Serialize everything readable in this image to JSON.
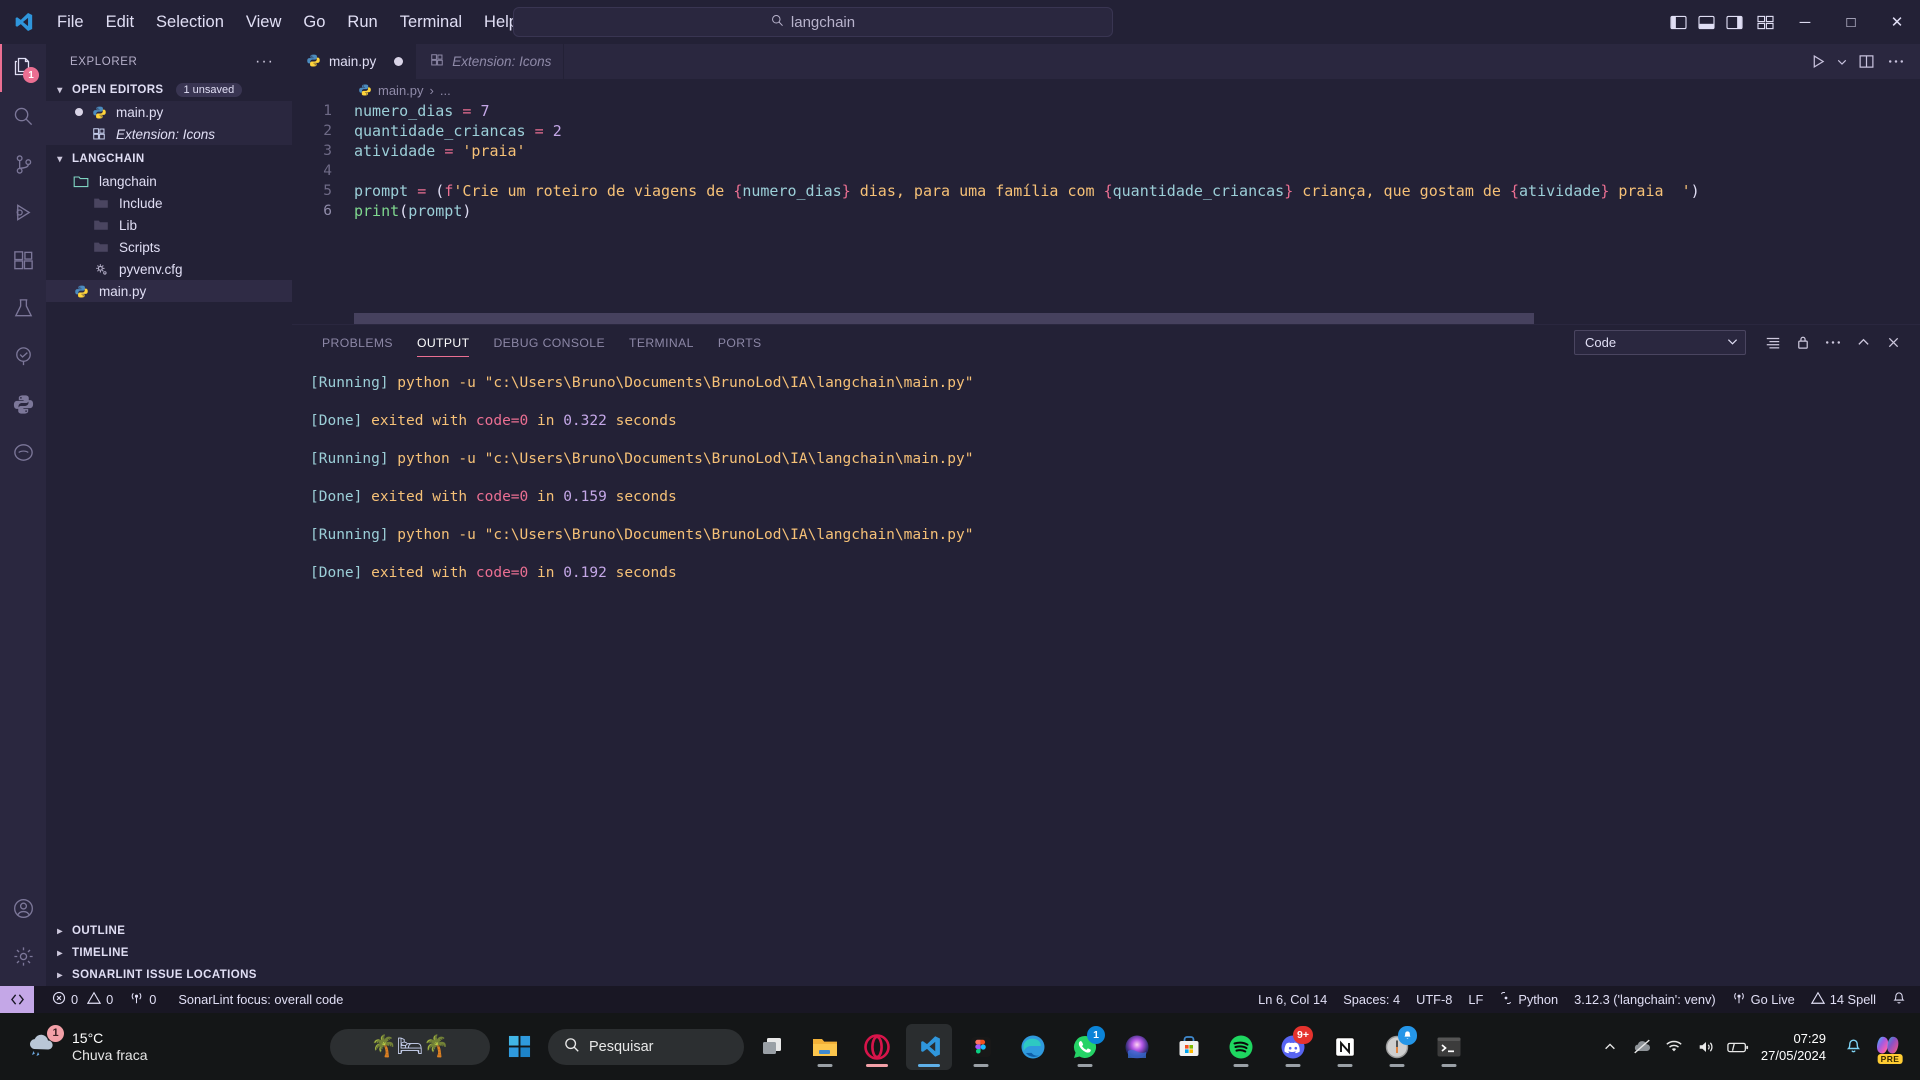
{
  "titlebar": {
    "menus": [
      "File",
      "Edit",
      "Selection",
      "View",
      "Go",
      "Run",
      "Terminal",
      "Help"
    ],
    "back_icon": "arrow-left-icon",
    "forward_icon": "arrow-right-icon",
    "command_center_value": "langchain",
    "command_center_icon": "search-icon",
    "layout_icons": [
      "toggle-primary-sidebar-icon",
      "toggle-panel-icon",
      "toggle-secondary-sidebar-icon",
      "customize-layout-icon"
    ],
    "window_controls": {
      "minimize": "─",
      "maximize": "□",
      "close": "✕"
    }
  },
  "activitybar": {
    "items": [
      {
        "name": "explorer",
        "icon": "files-icon",
        "active": true,
        "badge": "1"
      },
      {
        "name": "search",
        "icon": "search-icon",
        "active": false,
        "badge": ""
      },
      {
        "name": "source-control",
        "icon": "source-control-icon",
        "active": false,
        "badge": ""
      },
      {
        "name": "run-and-debug",
        "icon": "debug-icon",
        "active": false,
        "badge": ""
      },
      {
        "name": "extensions",
        "icon": "extensions-icon",
        "active": false,
        "badge": ""
      },
      {
        "name": "testing",
        "icon": "beaker-icon",
        "active": false,
        "badge": ""
      },
      {
        "name": "sonarlint",
        "icon": "sonarlint-tree-icon",
        "active": false,
        "badge": ""
      },
      {
        "name": "python",
        "icon": "python-icon",
        "active": false,
        "badge": ""
      },
      {
        "name": "docker",
        "icon": "docker-icon",
        "active": false,
        "badge": ""
      }
    ],
    "bottom": [
      {
        "name": "accounts",
        "icon": "account-icon"
      },
      {
        "name": "manage",
        "icon": "gear-icon"
      }
    ]
  },
  "sidebar": {
    "title": "EXPLORER",
    "more_actions": "···",
    "open_editors": {
      "label": "OPEN EDITORS",
      "badge": "1 unsaved",
      "items": [
        {
          "label": "main.py",
          "icon": "python-file-icon",
          "dirty": true,
          "italic": false
        },
        {
          "label": "Extension: Icons",
          "icon": "extensions-icon",
          "dirty": false,
          "italic": true
        }
      ]
    },
    "folder": {
      "label": "LANGCHAIN",
      "items": [
        {
          "label": "langchain",
          "icon": "folder-open-icon",
          "depth": 1
        },
        {
          "label": "Include",
          "icon": "folder-icon",
          "depth": 2
        },
        {
          "label": "Lib",
          "icon": "folder-icon",
          "depth": 2
        },
        {
          "label": "Scripts",
          "icon": "folder-icon",
          "depth": 2
        },
        {
          "label": "pyvenv.cfg",
          "icon": "config-file-icon",
          "depth": 2
        },
        {
          "label": "main.py",
          "icon": "python-file-icon",
          "depth": 1
        }
      ]
    },
    "bottom_sections": [
      "OUTLINE",
      "TIMELINE",
      "SONARLINT ISSUE LOCATIONS"
    ]
  },
  "editor": {
    "tabs": [
      {
        "label": "main.py",
        "icon": "python-file-icon",
        "active": true,
        "dirty": true,
        "italic": false
      },
      {
        "label": "Extension: Icons",
        "icon": "extensions-icon",
        "active": false,
        "dirty": false,
        "italic": true
      }
    ],
    "actions": [
      "run-python-file-icon",
      "chevron-down-icon",
      "split-editor-icon",
      "more-actions-icon"
    ],
    "breadcrumb": {
      "file": "main.py",
      "icon": "python-file-icon",
      "separator": "›",
      "rest": "..."
    },
    "lines": [
      {
        "n": "1",
        "tokens": [
          {
            "t": "numero_dias",
            "c": "c-var"
          },
          {
            "t": " ",
            "c": ""
          },
          {
            "t": "=",
            "c": "c-op"
          },
          {
            "t": " ",
            "c": ""
          },
          {
            "t": "7",
            "c": "c-num"
          }
        ]
      },
      {
        "n": "2",
        "tokens": [
          {
            "t": "quantidade_criancas",
            "c": "c-var"
          },
          {
            "t": " ",
            "c": ""
          },
          {
            "t": "=",
            "c": "c-op"
          },
          {
            "t": " ",
            "c": ""
          },
          {
            "t": "2",
            "c": "c-num"
          }
        ]
      },
      {
        "n": "3",
        "tokens": [
          {
            "t": "atividade",
            "c": "c-var"
          },
          {
            "t": " ",
            "c": ""
          },
          {
            "t": "=",
            "c": "c-op"
          },
          {
            "t": " ",
            "c": ""
          },
          {
            "t": "'praia'",
            "c": "c-str"
          }
        ]
      },
      {
        "n": "4",
        "tokens": []
      },
      {
        "n": "5",
        "tokens": [
          {
            "t": "prompt",
            "c": "c-var"
          },
          {
            "t": " ",
            "c": ""
          },
          {
            "t": "=",
            "c": "c-op"
          },
          {
            "t": " ",
            "c": ""
          },
          {
            "t": "(",
            "c": "c-punc"
          },
          {
            "t": "f",
            "c": "c-op"
          },
          {
            "t": "'Crie um roteiro de viagens de ",
            "c": "c-str"
          },
          {
            "t": "{",
            "c": "c-brace"
          },
          {
            "t": "numero_dias",
            "c": "c-var"
          },
          {
            "t": "}",
            "c": "c-brace"
          },
          {
            "t": " dias, para uma família com ",
            "c": "c-str"
          },
          {
            "t": "{",
            "c": "c-brace"
          },
          {
            "t": "quantidade_criancas",
            "c": "c-var"
          },
          {
            "t": "}",
            "c": "c-brace"
          },
          {
            "t": " criança, que gostam de ",
            "c": "c-str"
          },
          {
            "t": "{",
            "c": "c-brace"
          },
          {
            "t": "atividade",
            "c": "c-var"
          },
          {
            "t": "}",
            "c": "c-brace"
          },
          {
            "t": " praia  '",
            "c": "c-str"
          },
          {
            "t": ")",
            "c": "c-punc"
          }
        ]
      },
      {
        "n": "6",
        "tokens": [
          {
            "t": "print",
            "c": "c-fn"
          },
          {
            "t": "(",
            "c": "c-punc"
          },
          {
            "t": "prompt",
            "c": "c-var"
          },
          {
            "t": ")",
            "c": "c-punc"
          }
        ]
      }
    ]
  },
  "panel": {
    "tabs": [
      "PROBLEMS",
      "OUTPUT",
      "DEBUG CONSOLE",
      "TERMINAL",
      "PORTS"
    ],
    "active_tab": "OUTPUT",
    "channel_select": {
      "value": "Code",
      "icon": "chevron-down-icon"
    },
    "actions": [
      "clear-output-icon",
      "lock-scroll-icon",
      "more-actions-icon",
      "maximize-panel-icon",
      "close-panel-icon"
    ],
    "lines": [
      {
        "type": "running",
        "tag": "[Running]",
        "cmd": " python -u ",
        "path": "\"c:\\Users\\Bruno\\Documents\\BrunoLod\\IA\\langchain\\main.py\""
      },
      {
        "type": "blank"
      },
      {
        "type": "done",
        "tag": "[Done]",
        "mid": " exited with ",
        "code": "code=0",
        "in": " in ",
        "num": "0.322",
        "unit": " seconds"
      },
      {
        "type": "blank"
      },
      {
        "type": "running",
        "tag": "[Running]",
        "cmd": " python -u ",
        "path": "\"c:\\Users\\Bruno\\Documents\\BrunoLod\\IA\\langchain\\main.py\""
      },
      {
        "type": "blank"
      },
      {
        "type": "done",
        "tag": "[Done]",
        "mid": " exited with ",
        "code": "code=0",
        "in": " in ",
        "num": "0.159",
        "unit": " seconds"
      },
      {
        "type": "blank"
      },
      {
        "type": "running",
        "tag": "[Running]",
        "cmd": " python -u ",
        "path": "\"c:\\Users\\Bruno\\Documents\\BrunoLod\\IA\\langchain\\main.py\""
      },
      {
        "type": "blank"
      },
      {
        "type": "done",
        "tag": "[Done]",
        "mid": " exited with ",
        "code": "code=0",
        "in": " in ",
        "num": "0.192",
        "unit": " seconds"
      }
    ]
  },
  "statusbar": {
    "remote_icon": "remote-window-icon",
    "errors": "0",
    "warnings": "0",
    "ports": "0",
    "sonarlint": "SonarLint focus: overall code",
    "position": "Ln 6, Col 14",
    "spaces": "Spaces: 4",
    "encoding": "UTF-8",
    "eol": "LF",
    "language": "Python",
    "interpreter": "3.12.3 ('langchain': venv)",
    "golive": "Go Live",
    "spell": "14 Spell",
    "bell_icon": "bell-icon"
  },
  "taskbar": {
    "weather": {
      "temp": "15°C",
      "desc": "Chuva fraca",
      "badge": "1",
      "icon": "rain-cloud-icon"
    },
    "pill_icon": "palm-hammock-icon",
    "start_icon": "windows-start-icon",
    "search": {
      "placeholder": "Pesquisar",
      "icon": "search-icon"
    },
    "apps": [
      {
        "name": "task-view",
        "icon": "task-view-icon",
        "badge": "",
        "open": false
      },
      {
        "name": "file-explorer",
        "icon": "folder-icon",
        "badge": "",
        "open": true
      },
      {
        "name": "opera",
        "icon": "opera-icon",
        "badge": "",
        "open": true
      },
      {
        "name": "vscode",
        "icon": "vscode-icon",
        "badge": "",
        "open": true,
        "active": true
      },
      {
        "name": "figma",
        "icon": "figma-icon",
        "badge": "",
        "open": true
      },
      {
        "name": "edge",
        "icon": "edge-icon",
        "badge": "",
        "open": false
      },
      {
        "name": "whatsapp",
        "icon": "whatsapp-icon",
        "badge": "1",
        "open": true
      },
      {
        "name": "media-player",
        "icon": "media-icon",
        "badge": "",
        "open": false
      },
      {
        "name": "microsoft-store",
        "icon": "store-icon",
        "badge": "",
        "open": false
      },
      {
        "name": "spotify",
        "icon": "spotify-icon",
        "badge": "",
        "open": true
      },
      {
        "name": "discord",
        "icon": "discord-icon",
        "badge": "9+",
        "open": true
      },
      {
        "name": "notion",
        "icon": "notion-icon",
        "badge": "",
        "open": true
      },
      {
        "name": "clock",
        "icon": "clock-icon",
        "badge": "bell",
        "open": true
      },
      {
        "name": "terminal",
        "icon": "terminal-icon",
        "badge": "",
        "open": true
      }
    ],
    "tray": {
      "chevron": "show-hidden-icons-icon",
      "icons": [
        "onedrive-offline-icon",
        "wifi-icon",
        "volume-icon",
        "battery-icon"
      ],
      "time": "07:29",
      "date": "27/05/2024",
      "notification_icon": "bell-icon",
      "copilot_icon": "copilot-icon",
      "copilot_badge": "PRE"
    }
  }
}
